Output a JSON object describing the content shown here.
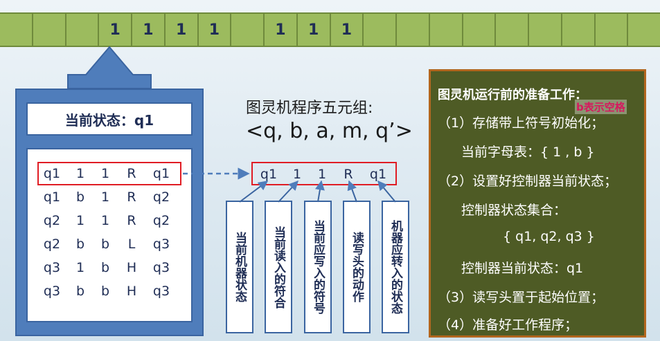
{
  "tape": {
    "cells": [
      "",
      "",
      "",
      "1",
      "1",
      "1",
      "1",
      "",
      "1",
      "1",
      "1",
      "",
      "",
      "",
      "",
      "",
      "",
      "",
      "",
      ""
    ]
  },
  "controller": {
    "current_state": "当前状态：q1"
  },
  "program": {
    "rows": [
      [
        "q1",
        "1",
        "1",
        "R",
        "q1"
      ],
      [
        "q1",
        "b",
        "1",
        "R",
        "q2"
      ],
      [
        "q2",
        "1",
        "1",
        "R",
        "q2"
      ],
      [
        "q2",
        "b",
        "b",
        "L",
        "q3"
      ],
      [
        "q3",
        "1",
        "b",
        "H",
        "q3"
      ],
      [
        "q3",
        "b",
        "b",
        "H",
        "q3"
      ]
    ],
    "highlighted_row": 0
  },
  "five_tuple": {
    "title": "图灵机程序五元组:",
    "tuple": "<q, b, a, m, q’>",
    "example": [
      "q1",
      "1",
      "1",
      "R",
      "q1"
    ],
    "components": [
      "当前机器状态",
      "当前读入的符合",
      "当前应写入的符号",
      "读写头的动作",
      "机器应转入的状态"
    ]
  },
  "preparation": {
    "title": "图灵机运行前的准备工作：",
    "lines": [
      "（1）存储带上符号初始化；",
      "当前字母表：{ 1 , b }",
      "（2）设置好控制器当前状态；",
      "控制器状态集合：",
      "{ q1, q2, q3 }",
      "控制器当前状态：q1",
      "（3）读写头置于起始位置；",
      "（4）准备好工作程序；"
    ],
    "note": "b表示空格"
  },
  "colors": {
    "tape": "#9cbb5e",
    "controller": "#4f7dbb",
    "highlight": "#e01c24",
    "prep_bg": "#4e5b25",
    "prep_border": "#b2661e",
    "note": "#d6195e"
  }
}
